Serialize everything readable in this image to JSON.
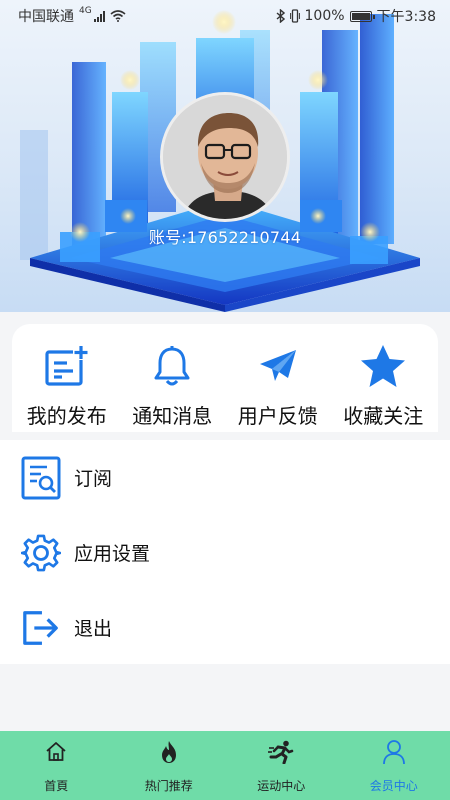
{
  "status_bar": {
    "carrier": "中国联通",
    "network": "4G",
    "battery": "100%",
    "time": "下午3:38"
  },
  "profile": {
    "account_text": "账号:17652210744"
  },
  "quick_actions": [
    {
      "label": "我的发布",
      "icon": "edit-note-icon"
    },
    {
      "label": "通知消息",
      "icon": "bell-icon"
    },
    {
      "label": "用户反馈",
      "icon": "paper-plane-icon"
    },
    {
      "label": "收藏关注",
      "icon": "star-icon"
    }
  ],
  "menu": [
    {
      "label": "订阅",
      "icon": "document-search-icon"
    },
    {
      "label": "应用设置",
      "icon": "gear-icon"
    },
    {
      "label": "退出",
      "icon": "logout-icon"
    }
  ],
  "bottom_nav": [
    {
      "label": "首頁",
      "icon": "home-icon"
    },
    {
      "label": "热门推荐",
      "icon": "flame-icon"
    },
    {
      "label": "运动中心",
      "icon": "runner-icon"
    },
    {
      "label": "会员中心",
      "icon": "user-icon",
      "active": true
    }
  ],
  "colors": {
    "accent_blue": "#1e78e6",
    "nav_green": "#6fdca8",
    "page_bg": "#f4f5f7"
  }
}
